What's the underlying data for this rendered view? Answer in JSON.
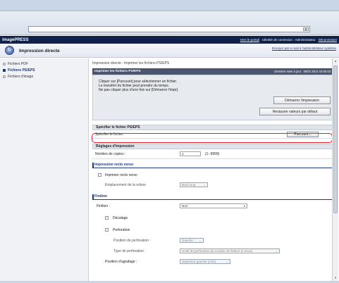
{
  "browser": {
    "address_value": ""
  },
  "header": {
    "logo": "imagePRESS",
    "portal_link": "Vers le portail",
    "identity_text": "Identité de connexion : Administrateur",
    "logout_link": "Déconnexion"
  },
  "subheader": {
    "title": "Impression directe",
    "admin_mail": "Envoyer par e-mail à l'administrateur système"
  },
  "sidebar": {
    "items": [
      {
        "label": "Fichiers PDF",
        "active": false
      },
      {
        "label": "Fichiers PS/EPS",
        "active": true
      },
      {
        "label": "Fichiers d'image",
        "active": false
      }
    ]
  },
  "main": {
    "breadcrumb": "Impression directe : Imprimer les fichiers PS/EPS",
    "panel": {
      "title": "Imprimer les fichiers PS/EPS",
      "last_update": "Dernière mise à jour : 00/02 2014 10:00:03",
      "msg_line1": "Cliquer sur [Parcourir] pour sélectionner un fichier.",
      "msg_line2": "Le transfert du fichier peut prendre du temps.",
      "msg_line3": "Ne pas cliquer plus d'une fois sur [Démarrer l'impr].",
      "start_button": "Démarrer l'impression",
      "restore_button": "Restaurer valeurs par défaut"
    },
    "file_section": {
      "title": "Spécifier le fichier PS/EPS",
      "label": "Spécifier le fichier:",
      "browse_button": "Parcourir..."
    },
    "print_settings": {
      "title": "Réglages d'impression",
      "copies_label": "Nombre de copies :",
      "copies_value": "1",
      "copies_range": "(1- 9999)"
    },
    "duplex": {
      "title": "Impression recto verso",
      "checkbox_label": "Imprimer recto verso",
      "binding_label": "Emplacement de la reliure",
      "binding_value": "Bord long"
    },
    "finishing": {
      "title": "Finition",
      "finishing_label": "Finition :",
      "finishing_value": "Non",
      "offset_label": "Décalage",
      "punch_label": "Perforation",
      "punch_position_label": "Position de perforation :",
      "punch_position_value": "Gauche",
      "punch_type_label": "Type de perforation :",
      "punch_type_value": "Unité de perforation du module de finition (2 trous)",
      "staple_label": "Position d'agrafage :",
      "staple_value": "Supérieur gauche (coin)"
    }
  },
  "colors": {
    "header_bg": "#10224a",
    "panel_head": "#4a5670",
    "highlight": "#e02020",
    "accent": "#1b3a7a"
  },
  "icons": [
    "dropdown-arrow-icon",
    "direct-print-icon"
  ]
}
